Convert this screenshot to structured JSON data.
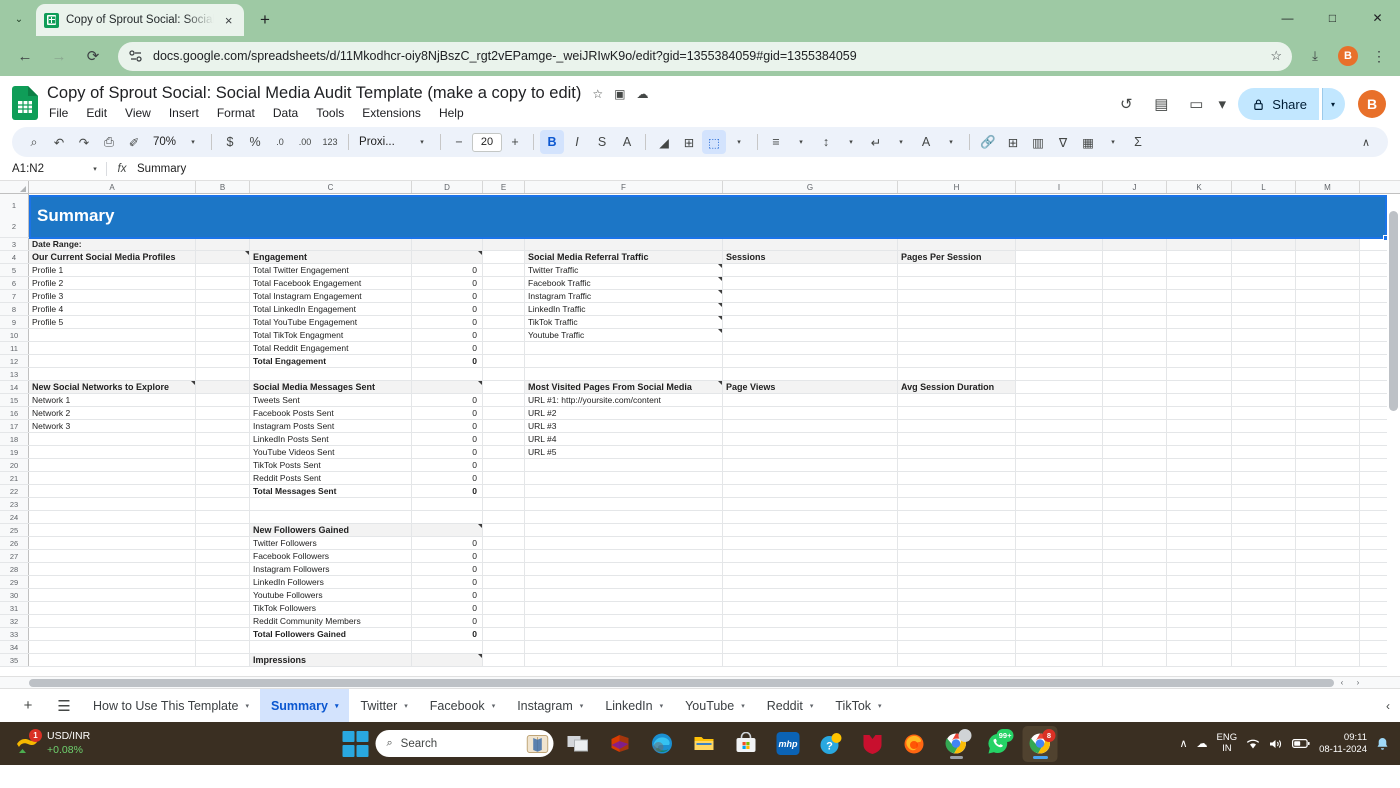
{
  "browser": {
    "tab": {
      "title": "Copy of Sprout Social: Social M",
      "favicon": "sheets-icon",
      "close": "×"
    },
    "new_tab": "+",
    "tab_list": "⌄",
    "window_controls": {
      "minimize": "—",
      "maximize": "□",
      "close": "✕"
    },
    "nav": {
      "back": "←",
      "forward": "→",
      "reload": "⟳"
    },
    "url": "docs.google.com/spreadsheets/d/11Mkodhcr-oiy8NjBszC_rgt2vEPamge-_weiJRIwK9o/edit?gid=1355384059#gid=1355384059",
    "star": "☆",
    "download": "⤓",
    "profile_initial": "B",
    "menu": "⋮"
  },
  "docs": {
    "title": "Copy of Sprout Social: Social Media Audit Template (make a copy to edit)",
    "star_icon": "☆",
    "move_icon": "▣",
    "cloud_icon": "☁",
    "menus": [
      "File",
      "Edit",
      "View",
      "Insert",
      "Format",
      "Data",
      "Tools",
      "Extensions",
      "Help"
    ],
    "history_icon": "↺",
    "comment_icon": "▤",
    "meet_icon": "▭",
    "meet_caret": "▾",
    "share_label": "Share",
    "share_lock": "🔒",
    "share_caret": "▾",
    "avatar_initial": "B"
  },
  "toolbar": {
    "search": "⌕",
    "undo": "↶",
    "redo": "↷",
    "print": "⎙",
    "paint_format": "✐",
    "zoom": "70%",
    "zoom_caret": "▾",
    "currency": "$",
    "percent": "%",
    "decrease_decimal": ".0",
    "increase_decimal": ".00",
    "more_formats": "123",
    "font": "Proxi...",
    "font_caret": "▾",
    "font_size_decrease": "−",
    "font_size": "20",
    "font_size_increase": "+",
    "bold": "B",
    "italic": "I",
    "strikethrough": "S",
    "text_color": "A",
    "fill_color": "◢",
    "borders": "⊞",
    "merge_cells": "⬚",
    "merge_caret": "▾",
    "align": "≡",
    "align_caret": "▾",
    "valign": "↕",
    "valign_caret": "▾",
    "wrap": "↵",
    "wrap_caret": "▾",
    "rotate": "A",
    "rotate_caret": "▾",
    "link": "🔗",
    "insert_comment": "⊞",
    "insert_chart": "▥",
    "filter": "∇",
    "functions_list": "▦",
    "functions_caret": "▾",
    "sigma": "Σ",
    "collapse": "∧"
  },
  "formula_bar": {
    "name_box": "A1:N2",
    "name_caret": "▾",
    "fx": "fx",
    "value": "Summary"
  },
  "grid": {
    "columns": [
      "A",
      "B",
      "C",
      "D",
      "E",
      "F",
      "G",
      "H",
      "I",
      "J",
      "K",
      "L",
      "M"
    ],
    "banner_title": "Summary",
    "rows": {
      "r3": {
        "num": "3",
        "a": "Date Range:"
      },
      "r4": {
        "num": "4",
        "a": "Our Current Social Media Profiles",
        "c": "Engagement",
        "f": "Social Media Referral Traffic",
        "g": "Sessions",
        "h": "Pages Per Session"
      },
      "r5": {
        "num": "5",
        "a": "Profile 1",
        "c": "Total Twitter Engagement",
        "d": "0",
        "f": "Twitter Traffic"
      },
      "r6": {
        "num": "6",
        "a": "Profile 2",
        "c": "Total Facebook Engagement",
        "d": "0",
        "f": "Facebook Traffic"
      },
      "r7": {
        "num": "7",
        "a": "Profile 3",
        "c": "Total Instagram Engagement",
        "d": "0",
        "f": "Instagram Traffic"
      },
      "r8": {
        "num": "8",
        "a": "Profile 4",
        "c": "Total LinkedIn Engagement",
        "d": "0",
        "f": "LinkedIn Traffic"
      },
      "r9": {
        "num": "9",
        "a": "Profile 5",
        "c": "Total YouTube Engagement",
        "d": "0",
        "f": "TikTok Traffic"
      },
      "r10": {
        "num": "10",
        "c": "Total TikTok Engagment",
        "d": "0",
        "f": "Youtube Traffic"
      },
      "r11": {
        "num": "11",
        "c": "Total Reddit Engagement",
        "d": "0"
      },
      "r12": {
        "num": "12",
        "c": "Total Engagement",
        "d": "0"
      },
      "r13": {
        "num": "13"
      },
      "r14": {
        "num": "14",
        "a": "New Social Networks to Explore",
        "c": "Social Media Messages Sent",
        "f": "Most Visited Pages From Social Media",
        "g": "Page Views",
        "h": "Avg Session Duration"
      },
      "r15": {
        "num": "15",
        "a": "Network 1",
        "c": "Tweets Sent",
        "d": "0",
        "f": "URL #1: http://yoursite.com/content"
      },
      "r16": {
        "num": "16",
        "a": "Network 2",
        "c": "Facebook Posts Sent",
        "d": "0",
        "f": "URL #2"
      },
      "r17": {
        "num": "17",
        "a": "Network 3",
        "c": "Instagram Posts Sent",
        "d": "0",
        "f": "URL #3"
      },
      "r18": {
        "num": "18",
        "c": "LinkedIn Posts Sent",
        "d": "0",
        "f": "URL #4"
      },
      "r19": {
        "num": "19",
        "c": "YouTube Videos Sent",
        "d": "0",
        "f": "URL #5"
      },
      "r20": {
        "num": "20",
        "c": "TikTok Posts Sent",
        "d": "0"
      },
      "r21": {
        "num": "21",
        "c": "Reddit Posts Sent",
        "d": "0"
      },
      "r22": {
        "num": "22",
        "c": "Total Messages Sent",
        "d": "0"
      },
      "r23": {
        "num": "23"
      },
      "r24": {
        "num": "24"
      },
      "r25": {
        "num": "25",
        "c": "New Followers Gained"
      },
      "r26": {
        "num": "26",
        "c": "Twitter Followers",
        "d": "0"
      },
      "r27": {
        "num": "27",
        "c": "Facebook Followers",
        "d": "0"
      },
      "r28": {
        "num": "28",
        "c": "Instagram Followers",
        "d": "0"
      },
      "r29": {
        "num": "29",
        "c": "LinkedIn Followers",
        "d": "0"
      },
      "r30": {
        "num": "30",
        "c": "Youtube Followers",
        "d": "0"
      },
      "r31": {
        "num": "31",
        "c": "TikTok Followers",
        "d": "0"
      },
      "r32": {
        "num": "32",
        "c": "Reddit Community Members",
        "d": "0"
      },
      "r33": {
        "num": "33",
        "c": "Total Followers Gained",
        "d": "0"
      },
      "r34": {
        "num": "34"
      },
      "r35": {
        "num": "35",
        "c": "Impressions"
      }
    },
    "hscroll_left": "‹",
    "hscroll_right": "›"
  },
  "sheet_tabs": {
    "add": "+",
    "all_sheets": "☰",
    "items": [
      {
        "label": "How to Use This Template",
        "caret": "▾",
        "active": false
      },
      {
        "label": "Summary",
        "caret": "▾",
        "active": true
      },
      {
        "label": "Twitter",
        "caret": "▾",
        "active": false
      },
      {
        "label": "Facebook",
        "caret": "▾",
        "active": false
      },
      {
        "label": "Instagram",
        "caret": "▾",
        "active": false
      },
      {
        "label": "LinkedIn",
        "caret": "▾",
        "active": false
      },
      {
        "label": "YouTube",
        "caret": "▾",
        "active": false
      },
      {
        "label": "Reddit",
        "caret": "▾",
        "active": false
      },
      {
        "label": "TikTok",
        "caret": "▾",
        "active": false
      }
    ],
    "scroll_left": "‹"
  },
  "taskbar": {
    "widget": {
      "title": "USD/INR",
      "change": "+0.08%",
      "badge": "1",
      "icon": "stocks-icon"
    },
    "start": "start-icon",
    "search_placeholder": "Search",
    "search_icon": "⌕",
    "copilot_icon": "copilot-icon",
    "apps": [
      {
        "name": "task-view",
        "glyph": "❐",
        "color": "#c9ccd1",
        "running": false
      },
      {
        "name": "microsoft-office",
        "glyph": "",
        "color": "#e0564a",
        "running": false
      },
      {
        "name": "microsoft-edge",
        "glyph": "",
        "color": "#2a7fd4",
        "running": false
      },
      {
        "name": "file-explorer",
        "glyph": "",
        "color": "#f7c04a",
        "running": false
      },
      {
        "name": "microsoft-store",
        "glyph": "",
        "color": "#e9edf2",
        "running": false
      },
      {
        "name": "mhp-app",
        "glyph": "mhp",
        "color": "#0b63b5",
        "running": false
      },
      {
        "name": "help-support",
        "glyph": "?",
        "color": "#29a8e0",
        "running": false
      },
      {
        "name": "mcafee",
        "glyph": "",
        "color": "#c8102e",
        "running": false
      },
      {
        "name": "mozilla-firefox",
        "glyph": "",
        "color": "#e66000",
        "running": false
      },
      {
        "name": "google-chrome",
        "glyph": "",
        "color": "#4285f4",
        "running": true,
        "badge": ""
      },
      {
        "name": "whatsapp",
        "glyph": "",
        "color": "#25d366",
        "running": false,
        "badge": "99+"
      },
      {
        "name": "google-chrome-active",
        "glyph": "",
        "color": "#4285f4",
        "running": true,
        "badge": "8",
        "active": true
      }
    ],
    "tray": {
      "chevron": "∧",
      "cloud": "☁",
      "lang_line1": "ENG",
      "lang_line2": "IN",
      "wifi": "◠",
      "volume": "🔊",
      "battery": "▣",
      "time": "09:11",
      "date": "08-11-2024",
      "notification": "🔔"
    }
  }
}
